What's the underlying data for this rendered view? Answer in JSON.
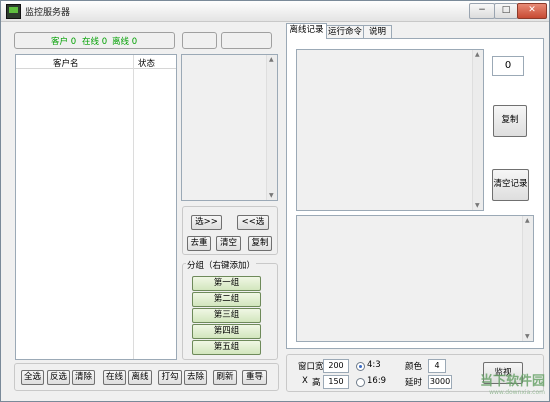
{
  "window": {
    "title": "监控服务器"
  },
  "caption_buttons": {
    "minimize": "−",
    "maximize": "□",
    "close": "✕"
  },
  "status_bar": {
    "customers_label": "客户 0",
    "online_label": "在线 0",
    "offline_label": "离线 0"
  },
  "client_list": {
    "columns": [
      "客户名",
      "状态"
    ]
  },
  "bottom_buttons": [
    "全选",
    "反选",
    "清除",
    "在线",
    "离线",
    "打勾",
    "去除",
    "刷新",
    "重导"
  ],
  "middle_buttons": {
    "move_right": "选>>",
    "move_left": "<<选",
    "dedupe": "去重",
    "clear": "清空",
    "copy": "复制"
  },
  "groups": {
    "title": "分组（右键添加）",
    "items": [
      "第一组",
      "第二组",
      "第三组",
      "第四组",
      "第五组"
    ]
  },
  "tabs": [
    "离线记录",
    "运行命令",
    "说明"
  ],
  "right_panel": {
    "count": "0",
    "copy_label": "复制",
    "clear_records_label": "清空记录"
  },
  "settings": {
    "width_label": "窗口宽",
    "width_value": "200",
    "height_label": "高",
    "height_prefix": "X",
    "height_value": "150",
    "ratio_43": "4:3",
    "ratio_169": "16:9",
    "color_label": "颜色",
    "color_value": "4",
    "delay_label": "延时",
    "delay_value": "3000",
    "monitor_label": "监视"
  },
  "watermark": {
    "brand": "当下软件园",
    "url": "www.downxia.com"
  }
}
